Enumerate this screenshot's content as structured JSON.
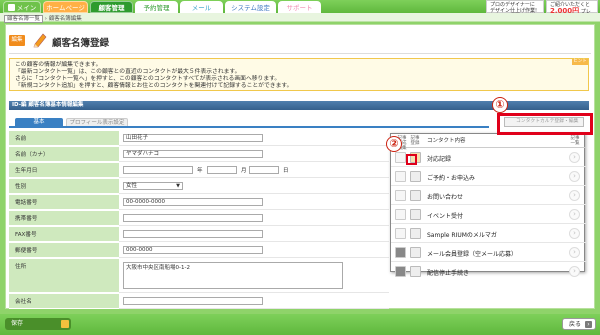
{
  "nav": {
    "tabs": [
      {
        "label": "メイン"
      },
      {
        "label": "ホームページ"
      },
      {
        "label": "顧客管理"
      },
      {
        "label": "予約管理"
      },
      {
        "label": "メール"
      },
      {
        "label": "システム設定"
      },
      {
        "label": "サポート"
      }
    ],
    "ad1": {
      "line1": "プロのデザイナーに",
      "line2": "デザイン仕上げ作業!"
    },
    "ad2": {
      "line1": "ご紹介いただくと",
      "price": "2,000円",
      "line3": "プレゼント"
    }
  },
  "breadcrumb": {
    "item1": "顧客名簿一覧",
    "sep": "›",
    "item2": "顧客名簿編集"
  },
  "page": {
    "badge": "編集",
    "title": "顧客名簿登録"
  },
  "notice": {
    "lines": [
      "この顧客の情報が編集できます。",
      "「最新コンタクト一覧」は、この顧客との直近のコンタクトが最大５件表示されます。",
      "さらに「コンタクト一覧へ」を押すと、この顧客とのコンタクトすべてが表示される画面へ移ります。",
      "「新規コンタクト追加」を押すと、顧客情報とお住とのコンタクトを関連付けて記録することができます。"
    ],
    "hint": "ヒント"
  },
  "section": {
    "title": "ID-編 顧客名簿基本情報編集"
  },
  "subtabs": {
    "basic": "基本",
    "profile": "プロフィール表示設定"
  },
  "contact_button": "コンタクトカルテ登録・編集",
  "form": {
    "name_label": "名前",
    "name_value": "山田花子",
    "kana_label": "名前（カナ）",
    "kana_value": "ヤマダハナコ",
    "birth_label": "生年月日",
    "year": "年",
    "month": "月",
    "day": "日",
    "gender_label": "性別",
    "gender_value": "女性",
    "phone_label": "電話番号",
    "phone_value": "00-0000-0000",
    "mobile_label": "携帯番号",
    "fax_label": "FAX番号",
    "zip_label": "郵便番号",
    "zip_value": "000-0000",
    "address_label": "住所",
    "address_value": "大阪市中央区南船場0-1-2",
    "company_label": "会社名"
  },
  "popup": {
    "col_edit": "記事作成\n編集",
    "col_entry": "記事\n登録",
    "col_content": "コンタクト内容",
    "col_list": "記事\n一覧",
    "items": [
      {
        "label": "対応記録"
      },
      {
        "label": "ご予約・お申込み"
      },
      {
        "label": "お問い合わせ"
      },
      {
        "label": "イベント受付"
      },
      {
        "label": "Sample RIUMのメルマガ"
      },
      {
        "label": "メール会員登録（空メール応募）"
      },
      {
        "label": "配信停止手続き"
      }
    ]
  },
  "annotations": {
    "one": "①",
    "two": "②"
  },
  "footer": {
    "save": "保存",
    "back": "戻る",
    "back_icon": "›"
  },
  "colors": {
    "accent_green": "#5fb83d",
    "orange": "#f18c1c",
    "highlight_red": "#e0001a",
    "section_blue": "#35608c"
  }
}
